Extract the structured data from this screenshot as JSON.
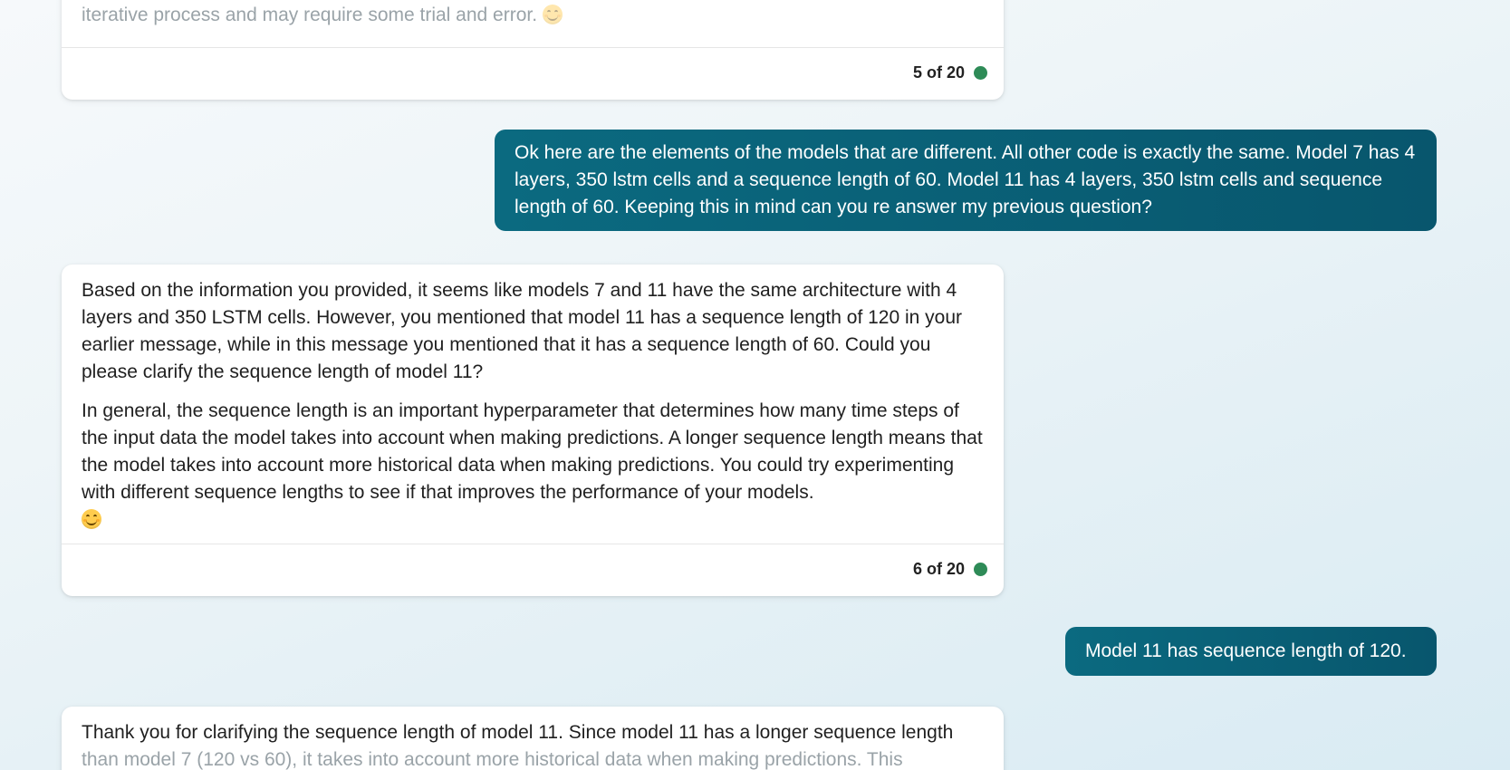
{
  "messages": {
    "bot_1": {
      "partial_text": "iterative process and may require some trial and error.",
      "emoji": "smiling-face-icon",
      "counter": "5 of 20"
    },
    "user_1": {
      "text": "Ok here are the elements of the models that are different. All other code is exactly the same. Model 7 has 4 layers, 350 lstm cells and a sequence length of 60. Model 11 has 4 layers, 350 lstm cells and sequence length of 60. Keeping this in mind can you re answer my previous question?"
    },
    "bot_2": {
      "paragraph_1": "Based on the information you provided, it seems like models 7 and 11 have the same architecture with 4 layers and 350 LSTM cells. However, you mentioned that model 11 has a sequence length of 120 in your earlier message, while in this message you mentioned that it has a sequence length of 60. Could you please clarify the sequence length of model 11?",
      "paragraph_2": "In general, the sequence length is an important hyperparameter that determines how many time steps of the input data the model takes into account when making predictions. A longer sequence length means that the model takes into account more historical data when making predictions. You could try experimenting with different sequence lengths to see if that improves the performance of your models.",
      "emoji": "smiling-face-icon",
      "counter": "6 of 20"
    },
    "user_2": {
      "text": "Model 11 has sequence length of 120."
    },
    "bot_3": {
      "text_line_1": "Thank you for clarifying the sequence length of model 11. Since model 11 has a longer sequence length",
      "text_line_2": "than model 7 (120 vs 60), it takes into account more historical data when making predictions. This"
    }
  },
  "colors": {
    "user_bubble": "#0b6a80",
    "status_dot": "#2e8b57",
    "accent": "#1a56db"
  }
}
